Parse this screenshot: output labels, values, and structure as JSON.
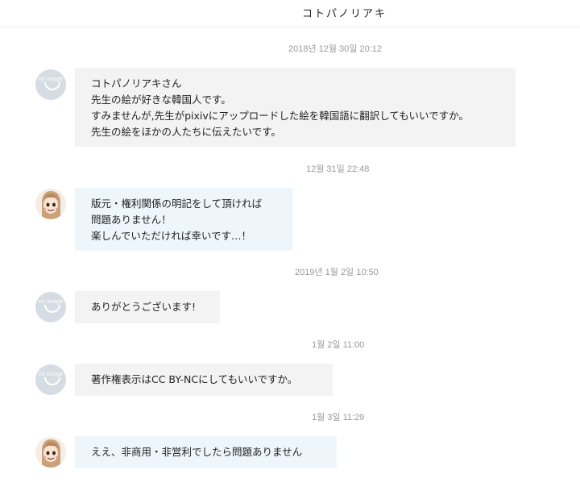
{
  "header": {
    "title": "コトパノリアキ"
  },
  "messages": [
    {
      "timestamp": "2018년 12월 30일 20:12",
      "sender": "other",
      "avatar_label": "no image",
      "lines": [
        "コトパノリアキさん",
        "先生の絵が好きな韓国人です。",
        "すみませんが,先生がpixivにアップロードした絵を韓国語に翻訳してもいいですか。",
        "先生の絵をほかの人たちに伝えたいです。"
      ]
    },
    {
      "timestamp": "12월 31일 22:48",
      "sender": "artist",
      "lines": [
        "版元・権利関係の明記をして頂ければ",
        "問題ありません！",
        "楽しんでいただければ幸いです…！"
      ]
    },
    {
      "timestamp": "2019년 1월 2일 10:50",
      "sender": "other",
      "avatar_label": "no image",
      "lines": [
        "ありがとうございます!"
      ]
    },
    {
      "timestamp": "1월 2일 11:00",
      "sender": "other",
      "avatar_label": "no image",
      "lines": [
        "著作権表示はCC BY-NCにしてもいいですか。"
      ]
    },
    {
      "timestamp": "1월 3일 11:29",
      "sender": "artist",
      "lines": [
        "ええ、非商用・非営利でしたら問題ありません"
      ]
    }
  ]
}
